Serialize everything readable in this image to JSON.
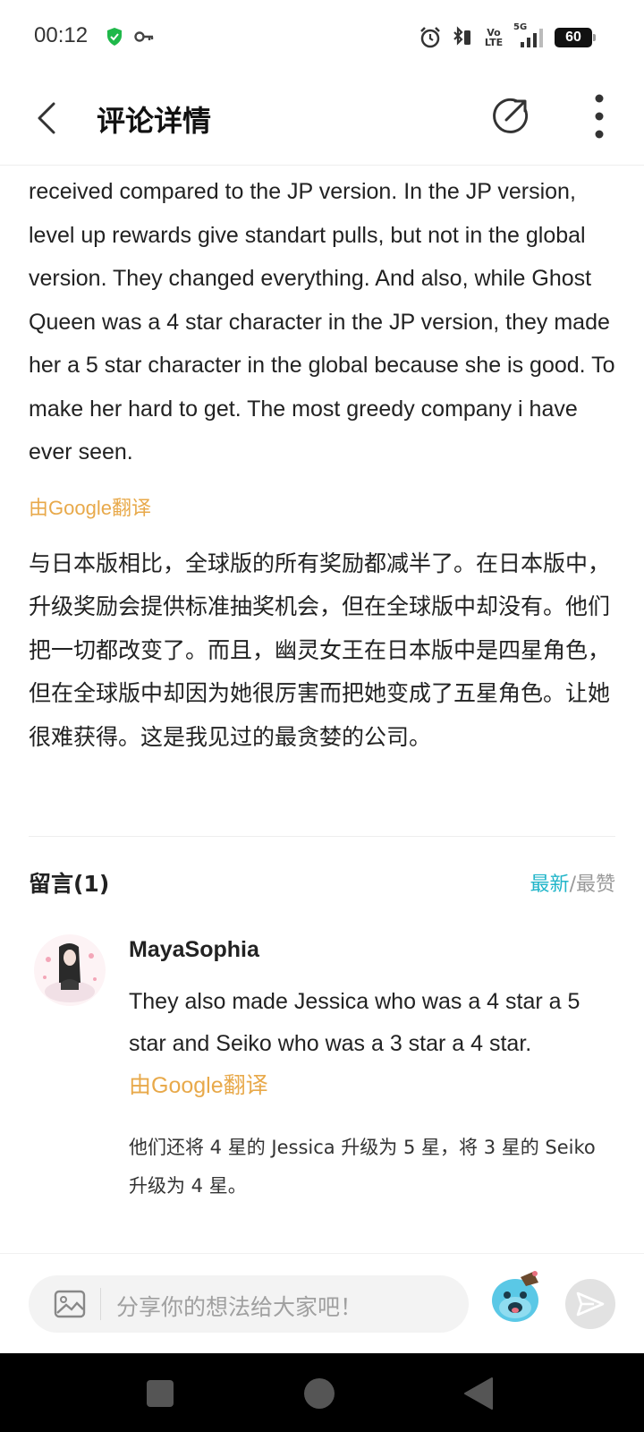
{
  "status_bar": {
    "time": "00:12",
    "lte_line1": "Vo",
    "lte_line2": "LTE",
    "network": "5G",
    "battery": "60"
  },
  "header": {
    "title": "评论详情"
  },
  "post": {
    "original_text": "received compared to the JP version. In the JP version, level up rewards give standart pulls, but not in the global version. They changed everything. And also, while Ghost Queen was a 4 star character in the JP  version, they made her a 5 star character in the global because she is good. To make her hard to get. The most greedy company i have ever seen.",
    "translate_tag": "由Google翻译",
    "translated_text": "与日本版相比，全球版的所有奖励都减半了。在日本版中，升级奖励会提供标准抽奖机会，但在全球版中却没有。他们把一切都改变了。而且，幽灵女王在日本版中是四星角色，但在全球版中却因为她很厉害而把她变成了五星角色。让她很难获得。这是我见过的最贪婪的公司。"
  },
  "comments": {
    "title": "留言(1)",
    "sort_newest": "最新",
    "sort_sep": "/",
    "sort_liked": "最赞",
    "items": [
      {
        "username": "MayaSophia",
        "text": "They also made Jessica who was a 4 star a 5 star and Seiko who was a 3 star a 4 star.",
        "translate_tag": "由Google翻译",
        "translated_text": "他们还将 4 星的 Jessica 升级为 5 星，将 3 星的 Seiko 升级为 4 星。"
      }
    ]
  },
  "input_bar": {
    "placeholder": "分享你的想法给大家吧！"
  },
  "colors": {
    "accent": "#21b5c9",
    "translate_tag": "#e8a94a",
    "muted": "#999999"
  }
}
